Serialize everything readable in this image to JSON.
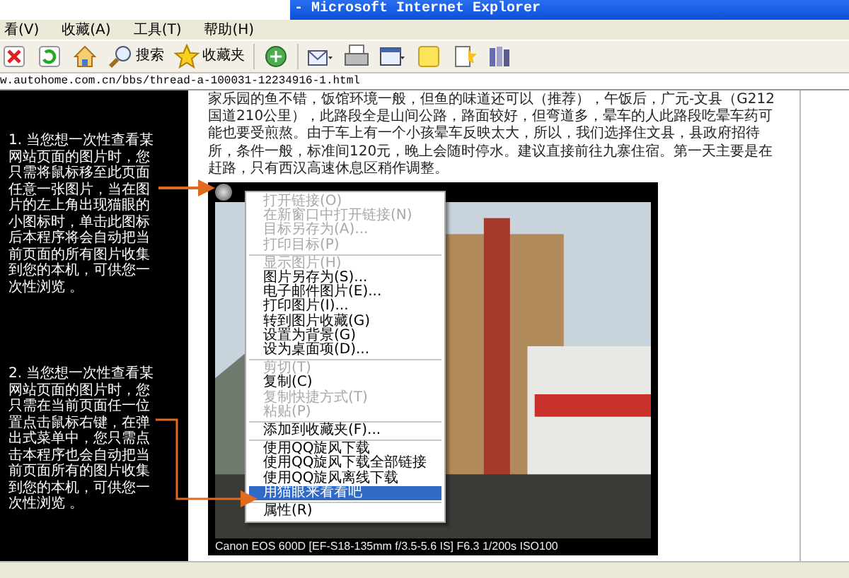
{
  "window": {
    "title": "- Microsoft Internet Explorer"
  },
  "menu_bar": [
    "看(V)",
    "收藏(A)",
    "工具(T)",
    "帮助(H)"
  ],
  "toolbar": [
    {
      "kind": "stop"
    },
    {
      "kind": "refresh"
    },
    {
      "kind": "home"
    },
    {
      "kind": "search",
      "label": "搜索"
    },
    {
      "kind": "favorites",
      "label": "收藏夹"
    },
    {
      "kind": "media"
    },
    {
      "kind": "mail"
    },
    {
      "kind": "print"
    },
    {
      "kind": "edit"
    },
    {
      "kind": "note"
    },
    {
      "kind": "tool"
    },
    {
      "kind": "book"
    }
  ],
  "address": "w.autohome.com.cn/bbs/thread-a-100031-12234916-1.html",
  "annotations": [
    {
      "text": "1. 当您想一次性查看某网站页面的图片时，您只需将鼠标移至此页面任意一张图片，当在图片的左上角出现猫眼的小图标时，单击此图标后本程序将会自动把当前页面的所有图片收集到您的本机，可供您一次性浏览 。"
    },
    {
      "text": "2. 当您想一次性查看某网站页面的图片时，您只需在当前页面任一位置点击鼠标右键，在弹出式菜单中，您只需点击本程序也会自动把当前页面所有的图片收集到您的本机，可供您一次性浏览 。"
    }
  ],
  "article": {
    "text": "家乐园的鱼不错，饭馆环境一般，但鱼的味道还可以（推荐），午饭后，广元-文县（G212国道210公里），此路段全是山间公路，路面较好，但弯道多，晕车的人此路段吃晕车药可能也要受煎熬。由于车上有一个小孩晕车反映太大，所以，我们选择住文县，县政府招待所，条件一般，标准间120元，晚上会随时停水。建议直接前往九寨住宿。第一天主要是在赶路，只有西汉高速休息区稍作调整。"
  },
  "photo": {
    "caption": "Canon EOS 600D [EF-S18-135mm f/3.5-5.6 IS] F6.3 1/200s ISO100"
  },
  "context_menu": {
    "items": [
      {
        "kind": "item",
        "label": "打开链接(O)",
        "disabled": true,
        "selected": false
      },
      {
        "kind": "item",
        "label": "在新窗口中打开链接(N)",
        "disabled": true,
        "selected": false
      },
      {
        "kind": "item",
        "label": "目标另存为(A)...",
        "disabled": true,
        "selected": false
      },
      {
        "kind": "item",
        "label": "打印目标(P)",
        "disabled": true,
        "selected": false
      },
      {
        "kind": "separator"
      },
      {
        "kind": "item",
        "label": "显示图片(H)",
        "disabled": true,
        "selected": false
      },
      {
        "kind": "item",
        "label": "图片另存为(S)...",
        "disabled": false,
        "selected": false
      },
      {
        "kind": "item",
        "label": "电子邮件图片(E)...",
        "disabled": false,
        "selected": false
      },
      {
        "kind": "item",
        "label": "打印图片(I)...",
        "disabled": false,
        "selected": false
      },
      {
        "kind": "item",
        "label": "转到图片收藏(G)",
        "disabled": false,
        "selected": false
      },
      {
        "kind": "item",
        "label": "设置为背景(G)",
        "disabled": false,
        "selected": false
      },
      {
        "kind": "item",
        "label": "设为桌面项(D)...",
        "disabled": false,
        "selected": false
      },
      {
        "kind": "separator"
      },
      {
        "kind": "item",
        "label": "剪切(T)",
        "disabled": true,
        "selected": false
      },
      {
        "kind": "item",
        "label": "复制(C)",
        "disabled": false,
        "selected": false
      },
      {
        "kind": "item",
        "label": "复制快捷方式(T)",
        "disabled": true,
        "selected": false
      },
      {
        "kind": "item",
        "label": "粘贴(P)",
        "disabled": true,
        "selected": false
      },
      {
        "kind": "separator"
      },
      {
        "kind": "item",
        "label": "添加到收藏夹(F)...",
        "disabled": false,
        "selected": false
      },
      {
        "kind": "separator"
      },
      {
        "kind": "item",
        "label": "使用QQ旋风下载",
        "disabled": false,
        "selected": false
      },
      {
        "kind": "item",
        "label": "使用QQ旋风下载全部链接",
        "disabled": false,
        "selected": false
      },
      {
        "kind": "item",
        "label": "使用QQ旋风离线下载",
        "disabled": false,
        "selected": false
      },
      {
        "kind": "item",
        "label": "用猫眼来看看吧",
        "disabled": false,
        "selected": true
      },
      {
        "kind": "separator"
      },
      {
        "kind": "item",
        "label": "属性(R)",
        "disabled": false,
        "selected": false
      }
    ]
  }
}
